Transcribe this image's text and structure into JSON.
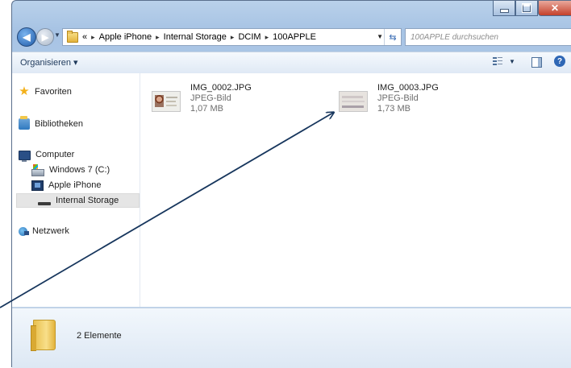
{
  "address_bar": {
    "overflow": "«",
    "crumbs": [
      "Apple iPhone",
      "Internal Storage",
      "DCIM",
      "100APPLE"
    ]
  },
  "search": {
    "placeholder": "100APPLE durchsuchen"
  },
  "toolbar": {
    "organize_label": "Organisieren ▾"
  },
  "nav_pane": {
    "favorites": "Favoriten",
    "libraries": "Bibliotheken",
    "computer": "Computer",
    "drive_c": "Windows 7 (C:)",
    "iphone": "Apple iPhone",
    "internal_storage": "Internal Storage",
    "network": "Netzwerk"
  },
  "files": [
    {
      "name": "IMG_0002.JPG",
      "type": "JPEG-Bild",
      "size": "1,07 MB"
    },
    {
      "name": "IMG_0003.JPG",
      "type": "JPEG-Bild",
      "size": "1,73 MB"
    }
  ],
  "details": {
    "item_count": "2 Elemente"
  },
  "colors": {
    "accent": "#1f5aa8",
    "frame": "#b9d1ea",
    "arrow": "#17365d"
  },
  "icons": [
    "back-icon",
    "forward-icon",
    "folder-icon",
    "refresh-icon",
    "search-icon",
    "views-icon",
    "preview-pane-icon",
    "help-icon",
    "star-icon",
    "library-icon",
    "computer-icon",
    "drive-icon",
    "phone-icon",
    "storage-icon",
    "network-icon",
    "minimize-icon",
    "maximize-icon",
    "close-icon"
  ]
}
